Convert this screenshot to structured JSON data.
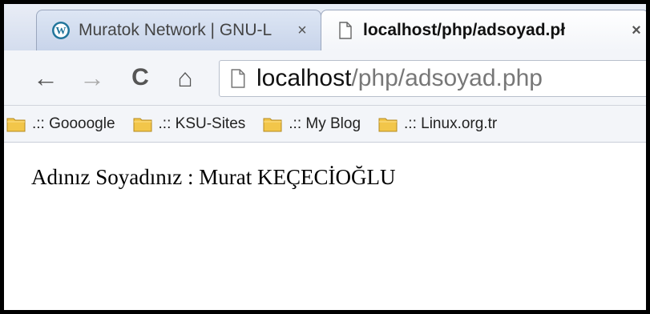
{
  "tabs": [
    {
      "title": "Muratok Network | GNU-L",
      "close": "×",
      "favicon": "wordpress-icon",
      "active": false
    },
    {
      "title": "localhost/php/adsoyad.pł",
      "close": "×",
      "favicon": "page-icon",
      "active": true
    }
  ],
  "toolbar": {
    "back_icon": "←",
    "forward_icon": "→",
    "reload_icon": "C",
    "home_icon": "⌂"
  },
  "omnibox": {
    "host": "localhost",
    "path": "/php/adsoyad.php"
  },
  "bookmarks": [
    {
      "label": ".:: Goooogle",
      "icon": "folder-icon"
    },
    {
      "label": ".:: KSU-Sites",
      "icon": "folder-icon"
    },
    {
      "label": ".:: My Blog",
      "icon": "folder-icon"
    },
    {
      "label": ".:: Linux.org.tr",
      "icon": "folder-icon"
    }
  ],
  "page": {
    "text": "Adınız Soyadınız : Murat KEÇECİOĞLU"
  },
  "colors": {
    "folder": "#f2c64a",
    "wordpress": "#21759b"
  }
}
